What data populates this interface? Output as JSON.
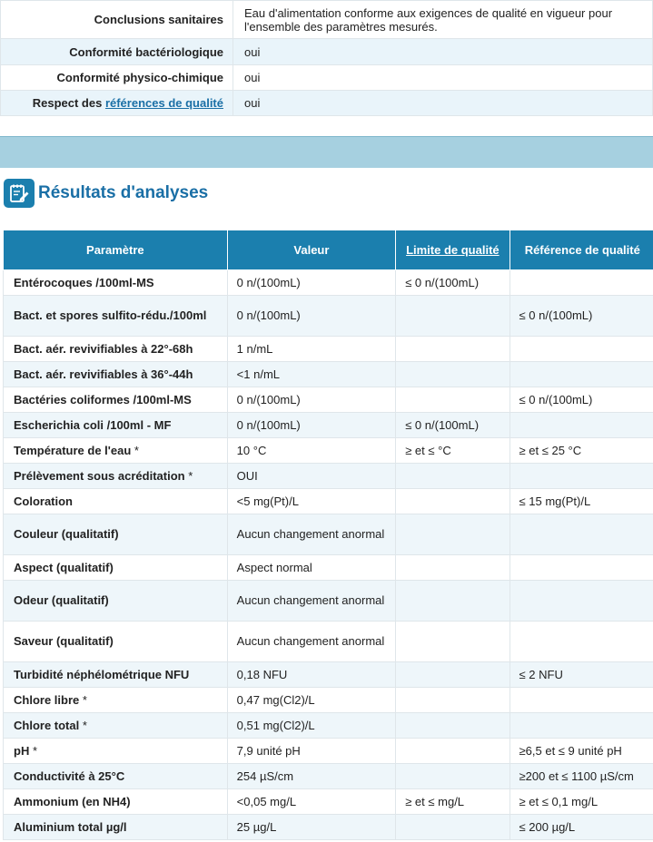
{
  "conclusions": [
    {
      "label": "Conclusions sanitaires",
      "value": "Eau d'alimentation conforme aux exigences de qualité en vigueur pour l'ensemble des paramètres mesurés."
    },
    {
      "label": "Conformité bactériologique",
      "value": "oui"
    },
    {
      "label": "Conformité physico-chimique",
      "value": "oui"
    },
    {
      "label_prefix": "Respect des ",
      "label_link": "références de qualité",
      "value": "oui"
    }
  ],
  "section": {
    "title": "Résultats d'analyses",
    "icon": "notepad-pencil-icon"
  },
  "results_header": {
    "param": "Paramètre",
    "value": "Valeur",
    "limit": "Limite de qualité",
    "reference": "Référence de qualité"
  },
  "results": [
    {
      "param": "Entérocoques /100ml-MS",
      "star": "",
      "value": "0 n/(100mL)",
      "limit": "≤ 0 n/(100mL)",
      "ref": ""
    },
    {
      "param": "Bact. et spores sulfito-rédu./100ml",
      "star": "",
      "value": "0 n/(100mL)",
      "limit": "",
      "ref": "≤ 0 n/(100mL)"
    },
    {
      "param": "Bact. aér. revivifiables à 22°-68h",
      "star": "",
      "value": "1 n/mL",
      "limit": "",
      "ref": ""
    },
    {
      "param": "Bact. aér. revivifiables à 36°-44h",
      "star": "",
      "value": "<1 n/mL",
      "limit": "",
      "ref": ""
    },
    {
      "param": "Bactéries coliformes /100ml-MS",
      "star": "",
      "value": "0 n/(100mL)",
      "limit": "",
      "ref": "≤ 0 n/(100mL)"
    },
    {
      "param": "Escherichia coli /100ml - MF",
      "star": "",
      "value": "0 n/(100mL)",
      "limit": "≤ 0 n/(100mL)",
      "ref": ""
    },
    {
      "param": "Température de l'eau",
      "star": " *",
      "value": "10 °C",
      "limit": "≥ et ≤ °C",
      "ref": "≥ et ≤ 25 °C"
    },
    {
      "param": "Prélèvement sous acréditation",
      "star": " *",
      "value": "OUI",
      "limit": "",
      "ref": ""
    },
    {
      "param": "Coloration",
      "star": "",
      "value": "<5 mg(Pt)/L",
      "limit": "",
      "ref": "≤ 15 mg(Pt)/L"
    },
    {
      "param": "Couleur (qualitatif)",
      "star": "",
      "value": "Aucun changement anormal",
      "limit": "",
      "ref": ""
    },
    {
      "param": "Aspect (qualitatif)",
      "star": "",
      "value": "Aspect normal",
      "limit": "",
      "ref": ""
    },
    {
      "param": "Odeur (qualitatif)",
      "star": "",
      "value": "Aucun changement anormal",
      "limit": "",
      "ref": ""
    },
    {
      "param": "Saveur (qualitatif)",
      "star": "",
      "value": "Aucun changement anormal",
      "limit": "",
      "ref": ""
    },
    {
      "param": "Turbidité néphélométrique NFU",
      "star": "",
      "value": "0,18 NFU",
      "limit": "",
      "ref": "≤ 2 NFU"
    },
    {
      "param": "Chlore libre",
      "star": " *",
      "value": "0,47 mg(Cl2)/L",
      "limit": "",
      "ref": ""
    },
    {
      "param": "Chlore total",
      "star": " *",
      "value": "0,51 mg(Cl2)/L",
      "limit": "",
      "ref": ""
    },
    {
      "param": "pH",
      "star": " *",
      "value": "7,9 unité pH",
      "limit": "",
      "ref": "≥6,5 et ≤ 9 unité pH"
    },
    {
      "param": "Conductivité à 25°C",
      "star": "",
      "value": "254 µS/cm",
      "limit": "",
      "ref": "≥200 et ≤ 1100 µS/cm"
    },
    {
      "param": "Ammonium (en NH4)",
      "star": "",
      "value": "<0,05 mg/L",
      "limit": "≥ et ≤ mg/L",
      "ref": "≥ et ≤ 0,1 mg/L"
    },
    {
      "param": "Aluminium total µg/l",
      "star": "",
      "value": "25 µg/L",
      "limit": "",
      "ref": "≤ 200 µg/L"
    }
  ]
}
